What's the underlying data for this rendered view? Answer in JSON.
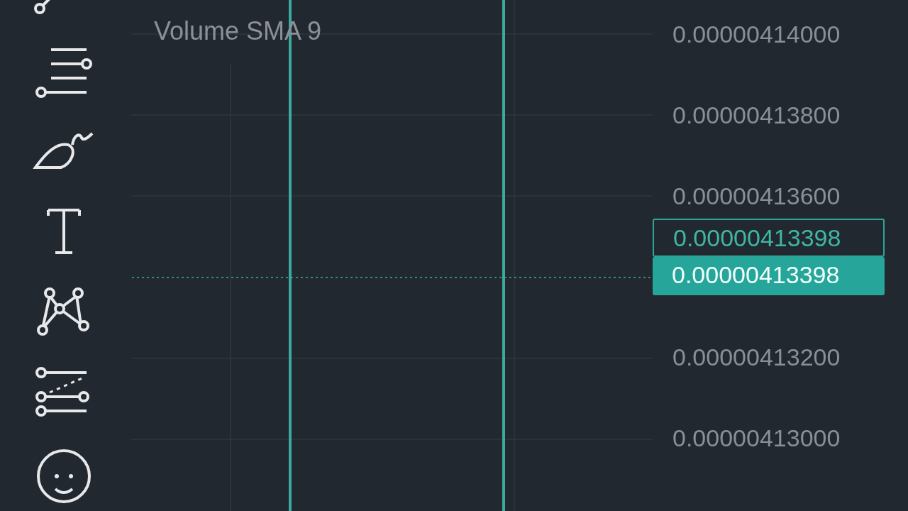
{
  "toolbar": {
    "tools": [
      {
        "kind": "trend-line"
      },
      {
        "kind": "fib"
      },
      {
        "kind": "brush"
      },
      {
        "kind": "text"
      },
      {
        "kind": "pattern"
      },
      {
        "kind": "prediction"
      },
      {
        "kind": "emoji"
      }
    ]
  },
  "legend": {
    "label": "Volume SMA 9"
  },
  "price_axis": {
    "ticks_above": [
      "0.00000414000",
      "0.00000413800",
      "0.00000413600"
    ],
    "crosshair_label": "0.00000413398",
    "last_price_label": "0.00000413398",
    "ticks_below": [
      "0.00000413200",
      "0.00000413000"
    ]
  }
}
